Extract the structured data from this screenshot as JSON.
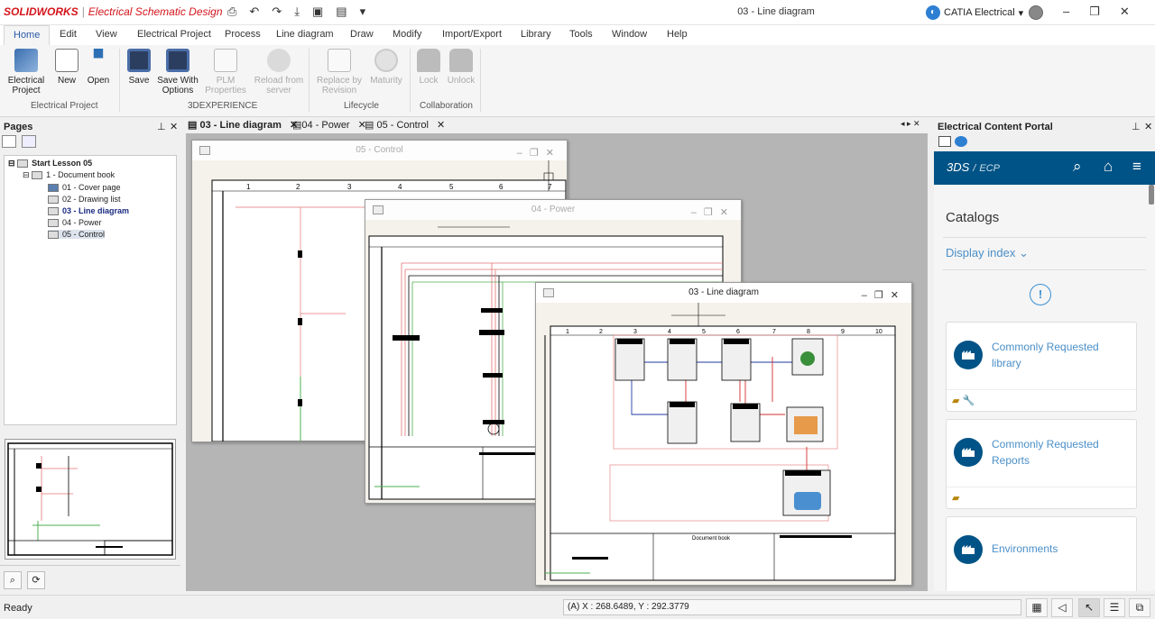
{
  "titlebar": {
    "brand": "SOLIDWORKS",
    "app_name": "Electrical Schematic Design",
    "document_title": "03 - Line diagram",
    "account_label": "CATIA Electrical"
  },
  "menu": [
    "Home",
    "Edit",
    "View",
    "Electrical Project",
    "Process",
    "Line diagram",
    "Draw",
    "Modify",
    "Import/Export",
    "Library",
    "Tools",
    "Window",
    "Help"
  ],
  "ribbon": {
    "buttons": [
      {
        "label1": "Electrical",
        "label2": "Project",
        "icon": "electrical-project-icon",
        "enabled": true
      },
      {
        "label1": "New",
        "label2": "",
        "icon": "new-icon",
        "enabled": true
      },
      {
        "label1": "Open",
        "label2": "",
        "icon": "open-icon",
        "enabled": true
      },
      {
        "label1": "Save",
        "label2": "",
        "icon": "save-icon",
        "enabled": true
      },
      {
        "label1": "Save With",
        "label2": "Options",
        "icon": "save-options-icon",
        "enabled": true
      },
      {
        "label1": "PLM",
        "label2": "Properties",
        "icon": "plm-properties-icon",
        "enabled": false
      },
      {
        "label1": "Reload from",
        "label2": "server",
        "icon": "reload-icon",
        "enabled": false
      },
      {
        "label1": "Replace by",
        "label2": "Revision",
        "icon": "replace-icon",
        "enabled": false
      },
      {
        "label1": "Maturity",
        "label2": "",
        "icon": "maturity-icon",
        "enabled": false
      },
      {
        "label1": "Lock",
        "label2": "",
        "icon": "lock-icon",
        "enabled": false
      },
      {
        "label1": "Unlock",
        "label2": "",
        "icon": "unlock-icon",
        "enabled": false
      }
    ],
    "groups": [
      "Electrical Project",
      "3DEXPERIENCE",
      "Lifecycle",
      "Collaboration"
    ]
  },
  "pages_panel": {
    "title": "Pages",
    "tree": [
      {
        "label": "Start Lesson 05",
        "level": 0,
        "bold": true
      },
      {
        "label": "1 - Document book",
        "level": 1,
        "bold": false
      },
      {
        "label": "01 - Cover page",
        "level": 2,
        "bold": false
      },
      {
        "label": "02 - Drawing list",
        "level": 2,
        "bold": false
      },
      {
        "label": "03 - Line diagram",
        "level": 2,
        "bold": true
      },
      {
        "label": "04 - Power",
        "level": 2,
        "bold": false
      },
      {
        "label": "05 - Control",
        "level": 2,
        "bold": false
      }
    ]
  },
  "doc_tabs": [
    "03 - Line diagram",
    "04 - Power",
    "05 - Control"
  ],
  "windows": {
    "control": "05 - Control",
    "power": "04 - Power",
    "line": "03 - Line diagram",
    "title_block": "Document book"
  },
  "ecp": {
    "panel_title": "Electrical Content Portal",
    "brand": "3DS",
    "brand_sub": "ECP",
    "catalogs": "Catalogs",
    "display_index": "Display index",
    "cards": [
      {
        "line1": "Commonly Requested",
        "line2": "library"
      },
      {
        "line1": "Commonly Requested",
        "line2": "Reports"
      },
      {
        "line1": "Environments",
        "line2": ""
      }
    ]
  },
  "status": {
    "text": "Ready",
    "coords": "(A) X : 268.6489, Y : 292.3779"
  }
}
